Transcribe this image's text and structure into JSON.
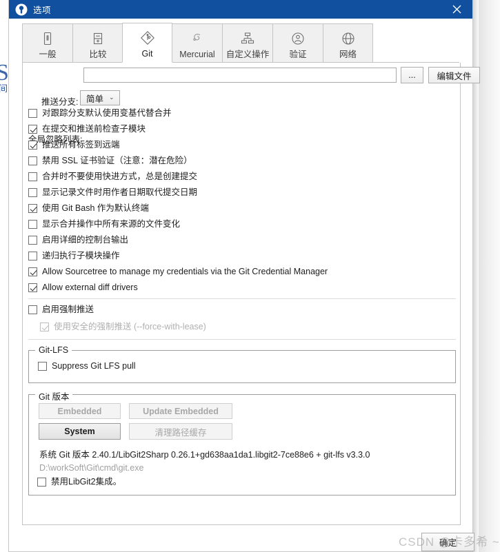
{
  "window": {
    "title": "选项",
    "icon": "sourcetree-logo-icon",
    "close_label": "×",
    "accent_color": "#11509E"
  },
  "tabs": [
    {
      "label": "一般",
      "icon": "general-icon",
      "selected": false
    },
    {
      "label": "比较",
      "icon": "diff-icon",
      "selected": false
    },
    {
      "label": "Git",
      "icon": "git-icon",
      "selected": true
    },
    {
      "label": "Mercurial",
      "icon": "mercurial-icon",
      "selected": false
    },
    {
      "label": "自定义操作",
      "icon": "custom-actions-icon",
      "selected": false
    },
    {
      "label": "验证",
      "icon": "authentication-icon",
      "selected": false
    },
    {
      "label": "网络",
      "icon": "network-icon",
      "selected": false
    }
  ],
  "git_panel": {
    "global_ignore": {
      "label": "全局忽略列表:",
      "value": "",
      "placeholder": "",
      "browse_label": "...",
      "edit_file_label": "编辑文件"
    },
    "push_branch": {
      "label": "推送分支:",
      "value": "简单",
      "caret": "⌄"
    },
    "checkboxes": [
      {
        "label": "对跟踪分支默认使用变基代替合并",
        "checked": false,
        "disabled": false
      },
      {
        "label": "在提交和推送前检查子模块",
        "checked": true,
        "disabled": false
      },
      {
        "label": "推送所有标签到远端",
        "checked": true,
        "disabled": false
      },
      {
        "label": "禁用 SSL 证书验证（注意：潜在危险）",
        "checked": false,
        "disabled": false
      },
      {
        "label": "合并时不要使用快进方式，总是创建提交",
        "checked": false,
        "disabled": false
      },
      {
        "label": "显示记录文件时用作者日期取代提交日期",
        "checked": false,
        "disabled": false
      },
      {
        "label": "使用 Git Bash 作为默认终端",
        "checked": true,
        "disabled": false
      },
      {
        "label": "显示合并操作中所有来源的文件变化",
        "checked": false,
        "disabled": false
      },
      {
        "label": "启用详细的控制台输出",
        "checked": false,
        "disabled": false
      },
      {
        "label": "递归执行子模块操作",
        "checked": false,
        "disabled": false
      },
      {
        "label": "Allow Sourcetree to manage my credentials via the Git Credential Manager",
        "checked": true,
        "disabled": false
      },
      {
        "label": "Allow external diff drivers",
        "checked": true,
        "disabled": false
      }
    ],
    "force_push": {
      "enable": {
        "label": "启用强制推送",
        "checked": false,
        "disabled": false
      },
      "safe": {
        "label": "使用安全的强制推送 (--force-with-lease)",
        "checked": true,
        "disabled": true
      }
    },
    "lfs_group": {
      "title": "Git-LFS",
      "suppress_pull": {
        "label": "Suppress Git LFS pull",
        "checked": false
      }
    },
    "version_group": {
      "title": "Git 版本",
      "buttons": {
        "embedded": {
          "label": "Embedded",
          "disabled": true,
          "selected": false
        },
        "update_embedded": {
          "label": "Update Embedded",
          "disabled": true,
          "selected": false
        },
        "system": {
          "label": "System",
          "disabled": false,
          "selected": true
        },
        "clear_path_cache": {
          "label": "清理路径缓存",
          "disabled": true,
          "selected": false
        }
      },
      "version_text": "系统 Git 版本 2.40.1/LibGit2Sharp 0.26.1+gd638aa1da1.libgit2-7ce88e6 + git-lfs v3.3.0",
      "path_text": "D:\\workSoft\\Git\\cmd\\git.exe",
      "disable_libgit2": {
        "label": "禁用LibGit2集成。",
        "checked": false
      }
    }
  },
  "footer": {
    "ok_label": "确定"
  },
  "watermark": {
    "text": "CSDN @卡多希 ~"
  },
  "backdrop": {
    "glyph": "S",
    "glyph2": "间"
  }
}
